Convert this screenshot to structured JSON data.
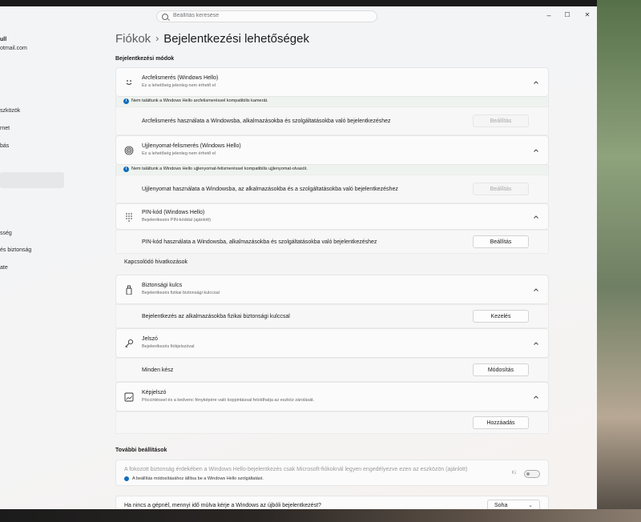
{
  "window": {
    "search_placeholder": "Beállítás keresése",
    "controls": {
      "minimize": "–",
      "maximize": "☐",
      "close": "✕"
    }
  },
  "sidebar": {
    "user_name": "ull",
    "user_email": "otmail.com",
    "items": [
      "szközök",
      "rnet",
      "bás",
      "sség",
      "és biztonság",
      "ate"
    ]
  },
  "breadcrumb": {
    "parent": "Fiókok",
    "separator": "›",
    "current": "Bejelentkezési lehetőségek"
  },
  "sections": {
    "signin_methods": "Bejelentkezési módok",
    "related_links": "Kapcsolódó hivatkozások",
    "additional": "További beállítások"
  },
  "face": {
    "title": "Arcfelismerés (Windows Hello)",
    "desc": "Ez a lehetőség jelenleg nem érhető el",
    "warning": "Nem találtunk a Windows Hello arcfelismeréssel kompatibilis kamerát.",
    "row_text": "Arcfelismerés használata a Windowsba, alkalmazásokba és szolgáltatásokba való bejelentkezéshez",
    "button": "Beállítás"
  },
  "fingerprint": {
    "title": "Ujjlenyomat-felismerés (Windows Hello)",
    "desc": "Ez a lehetőség jelenleg nem érhető el",
    "warning": "Nem találtunk a Windows Hello ujjlenyomat-felismeréssel kompatibilis ujjlenyomat-olvasót.",
    "row_text": "Ujjlenyomat használata a Windowsba, az alkalmazásokba és a szolgáltatásokba való bejelentkezéshez",
    "button": "Beállítás"
  },
  "pin": {
    "title": "PIN-kód (Windows Hello)",
    "desc": "Bejelentkezés PIN-kóddal (ajánlott)",
    "row_text": "PIN-kód használata a Windowsba, alkalmazásokba és szolgáltatásokba való bejelentkezéshez",
    "button": "Beállítás"
  },
  "security_key": {
    "title": "Biztonsági kulcs",
    "desc": "Bejelentkezés fizikai biztonsági kulccsal",
    "row_text": "Bejelentkezés az alkalmazásokba fizikai biztonsági kulccsal",
    "button": "Kezelés"
  },
  "password": {
    "title": "Jelszó",
    "desc": "Bejelentkezés fiókjelszóval",
    "row_text": "Minden kész",
    "button": "Módosítás"
  },
  "picture_password": {
    "title": "Képjelszó",
    "desc": "Pöccintéssel és a kedvenc fényképére való koppintással feloldhatja az eszköz zárolását.",
    "button": "Hozzáadás"
  },
  "hello_only": {
    "text": "A fokozott biztonság érdekében a Windows Hello-bejelentkezés csak Microsoft-fiókoknál legyen engedélyezve ezen az eszközön (ajánlott)",
    "note": "A beállítás módosításához állítsa be a Windows Hello szolgáltatást.",
    "toggle_label": "Ki",
    "toggle_on": false
  },
  "relogin": {
    "text": "Ha nincs a gépnél, mennyi idő múlva kérje a Windows az újbóli bejelentkezést?",
    "value": "Soha"
  },
  "colors": {
    "accent": "#0f6cbd",
    "window_bg": "#f3f3f3"
  }
}
